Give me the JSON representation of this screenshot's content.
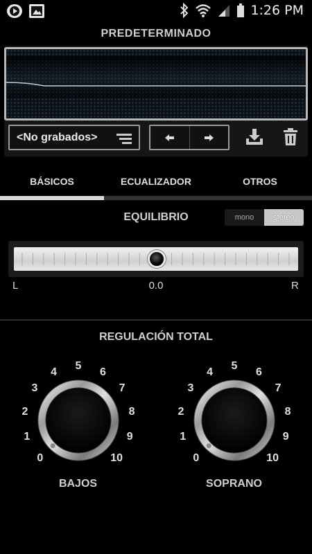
{
  "status_bar": {
    "time": "1:26 PM",
    "left_icons": [
      "play-circle-icon",
      "image-icon"
    ],
    "right_icons": [
      "bluetooth-icon",
      "wifi-icon",
      "signal-icon",
      "battery-icon"
    ]
  },
  "preset": {
    "title": "PREDETERMINADO",
    "selected": "<No grabados>"
  },
  "tabs": [
    {
      "label": "BÁSICOS",
      "active": true
    },
    {
      "label": "ECUALIZADOR",
      "active": false
    },
    {
      "label": "OTROS",
      "active": false
    }
  ],
  "balance": {
    "title": "EQUILIBRIO",
    "mode_options": [
      "mono",
      "stereo"
    ],
    "mode_selected": "stereo",
    "left_label": "L",
    "right_label": "R",
    "value": "0.0"
  },
  "tone": {
    "title": "REGULACIÓN TOTAL",
    "scale": [
      "0",
      "1",
      "2",
      "3",
      "4",
      "5",
      "6",
      "7",
      "8",
      "9",
      "10"
    ],
    "knobs": [
      {
        "label": "BAJOS",
        "value": 0
      },
      {
        "label": "SOPRANO",
        "value": 0
      }
    ]
  }
}
